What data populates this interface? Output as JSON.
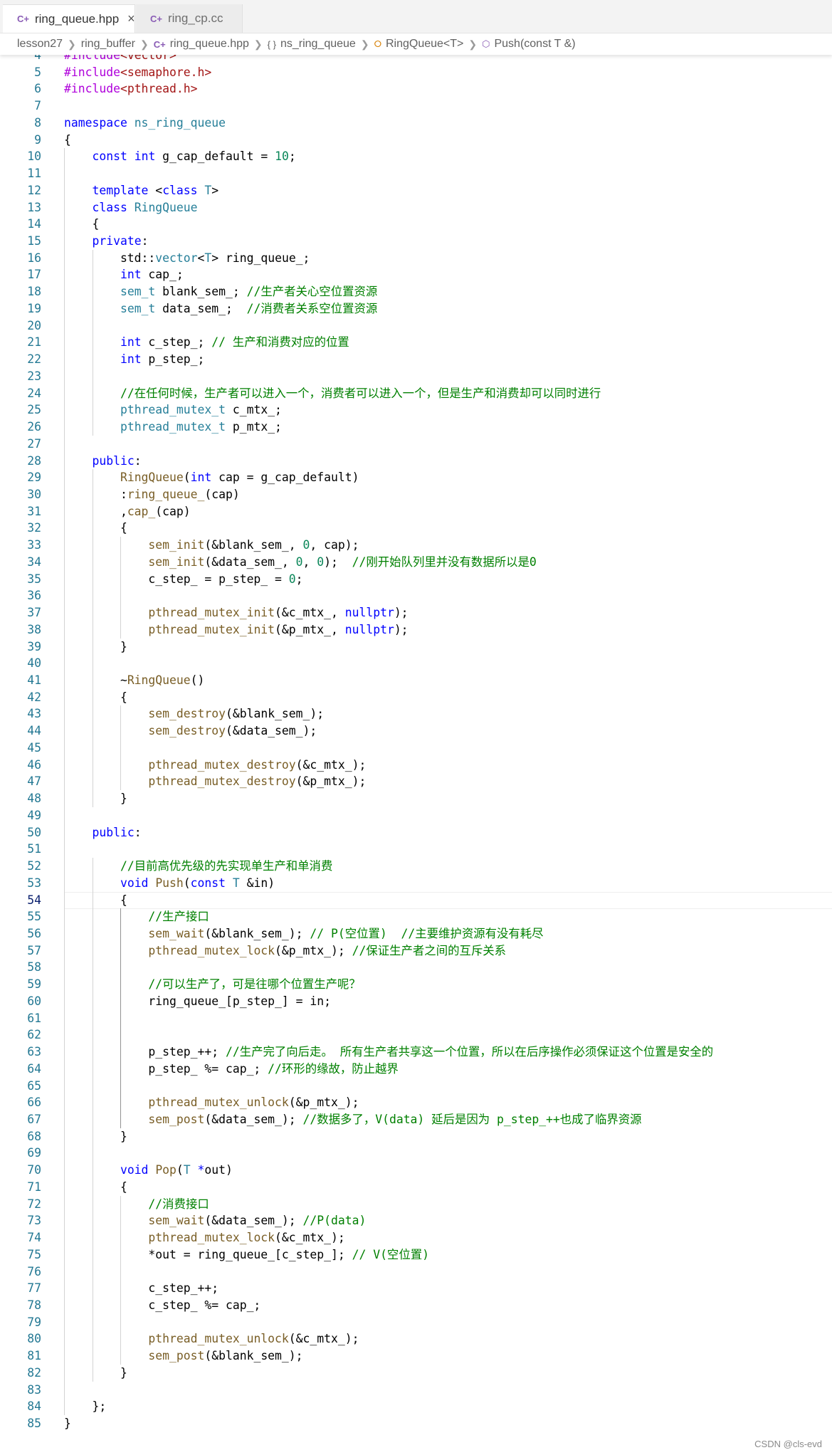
{
  "tabs": [
    {
      "label": "ring_queue.hpp",
      "active": true,
      "icon": "cpp-file-icon"
    },
    {
      "label": "ring_cp.cc",
      "active": false,
      "icon": "cpp-file-icon"
    }
  ],
  "breadcrumb": [
    "lesson27",
    "ring_buffer",
    "ring_queue.hpp",
    "ns_ring_queue",
    "RingQueue<T>",
    "Push(const T &)"
  ],
  "watermark": "CSDN @cls-evd",
  "current_line": 54,
  "lines": [
    {
      "n": 4,
      "t": [
        [
          "#include",
          "pp"
        ],
        [
          "<vector>",
          "str"
        ]
      ]
    },
    {
      "n": 5,
      "t": [
        [
          "#include",
          "pp"
        ],
        [
          "<semaphore.h>",
          "str"
        ]
      ]
    },
    {
      "n": 6,
      "t": [
        [
          "#include",
          "pp"
        ],
        [
          "<pthread.h>",
          "str"
        ]
      ]
    },
    {
      "n": 7,
      "t": []
    },
    {
      "n": 8,
      "t": [
        [
          "namespace",
          "kw"
        ],
        [
          " "
        ],
        [
          "ns_ring_queue",
          "ty"
        ]
      ]
    },
    {
      "n": 9,
      "t": [
        [
          "{"
        ]
      ]
    },
    {
      "n": 10,
      "t": [
        [
          "    "
        ],
        [
          "const",
          "kw"
        ],
        [
          " "
        ],
        [
          "int",
          "kw"
        ],
        [
          " g_cap_default = "
        ],
        [
          "10",
          "num"
        ],
        [
          ";"
        ]
      ]
    },
    {
      "n": 11,
      "t": []
    },
    {
      "n": 12,
      "t": [
        [
          "    "
        ],
        [
          "template",
          "kw"
        ],
        [
          " <"
        ],
        [
          "class",
          "kw"
        ],
        [
          " "
        ],
        [
          "T",
          "ty"
        ],
        [
          ">"
        ]
      ]
    },
    {
      "n": 13,
      "t": [
        [
          "    "
        ],
        [
          "class",
          "kw"
        ],
        [
          " "
        ],
        [
          "RingQueue",
          "ty"
        ]
      ]
    },
    {
      "n": 14,
      "t": [
        [
          "    {"
        ]
      ]
    },
    {
      "n": 15,
      "t": [
        [
          "    "
        ],
        [
          "private",
          "kw"
        ],
        [
          ":"
        ]
      ]
    },
    {
      "n": 16,
      "t": [
        [
          "        std::"
        ],
        [
          "vector",
          "ty"
        ],
        [
          "<"
        ],
        [
          "T",
          "ty"
        ],
        [
          "> ring_queue_;"
        ]
      ]
    },
    {
      "n": 17,
      "t": [
        [
          "        "
        ],
        [
          "int",
          "kw"
        ],
        [
          " cap_;"
        ]
      ]
    },
    {
      "n": 18,
      "t": [
        [
          "        "
        ],
        [
          "sem_t",
          "ty"
        ],
        [
          " blank_sem_; "
        ],
        [
          "//生产者关心空位置资源",
          "cm"
        ]
      ]
    },
    {
      "n": 19,
      "t": [
        [
          "        "
        ],
        [
          "sem_t",
          "ty"
        ],
        [
          " data_sem_;  "
        ],
        [
          "//消费者关系空位置资源",
          "cm"
        ]
      ]
    },
    {
      "n": 20,
      "t": []
    },
    {
      "n": 21,
      "t": [
        [
          "        "
        ],
        [
          "int",
          "kw"
        ],
        [
          " c_step_; "
        ],
        [
          "// 生产和消费对应的位置",
          "cm"
        ]
      ]
    },
    {
      "n": 22,
      "t": [
        [
          "        "
        ],
        [
          "int",
          "kw"
        ],
        [
          " p_step_;"
        ]
      ]
    },
    {
      "n": 23,
      "t": []
    },
    {
      "n": 24,
      "t": [
        [
          "        "
        ],
        [
          "//在任何时候，生产者可以进入一个，消费者可以进入一个，但是生产和消费却可以同时进行",
          "cm"
        ]
      ]
    },
    {
      "n": 25,
      "t": [
        [
          "        "
        ],
        [
          "pthread_mutex_t",
          "ty"
        ],
        [
          " c_mtx_;"
        ]
      ]
    },
    {
      "n": 26,
      "t": [
        [
          "        "
        ],
        [
          "pthread_mutex_t",
          "ty"
        ],
        [
          " p_mtx_;"
        ]
      ]
    },
    {
      "n": 27,
      "t": []
    },
    {
      "n": 28,
      "t": [
        [
          "    "
        ],
        [
          "public",
          "kw"
        ],
        [
          ":"
        ]
      ]
    },
    {
      "n": 29,
      "t": [
        [
          "        "
        ],
        [
          "RingQueue",
          "fn"
        ],
        [
          "("
        ],
        [
          "int",
          "kw"
        ],
        [
          " cap = g_cap_default)"
        ]
      ]
    },
    {
      "n": 30,
      "t": [
        [
          "        :"
        ],
        [
          "ring_queue_",
          "fn"
        ],
        [
          "(cap)"
        ]
      ]
    },
    {
      "n": 31,
      "t": [
        [
          "        ,"
        ],
        [
          "cap_",
          "fn"
        ],
        [
          "(cap)"
        ]
      ]
    },
    {
      "n": 32,
      "t": [
        [
          "        {"
        ]
      ]
    },
    {
      "n": 33,
      "t": [
        [
          "            "
        ],
        [
          "sem_init",
          "fn"
        ],
        [
          "(&blank_sem_, "
        ],
        [
          "0",
          "num"
        ],
        [
          ", cap);"
        ]
      ]
    },
    {
      "n": 34,
      "t": [
        [
          "            "
        ],
        [
          "sem_init",
          "fn"
        ],
        [
          "(&data_sem_, "
        ],
        [
          "0",
          "num"
        ],
        [
          ", "
        ],
        [
          "0",
          "num"
        ],
        [
          ");  "
        ],
        [
          "//刚开始队列里并没有数据所以是0",
          "cm"
        ]
      ]
    },
    {
      "n": 35,
      "t": [
        [
          "            c_step_ = p_step_ = "
        ],
        [
          "0",
          "num"
        ],
        [
          ";"
        ]
      ]
    },
    {
      "n": 36,
      "t": []
    },
    {
      "n": 37,
      "t": [
        [
          "            "
        ],
        [
          "pthread_mutex_init",
          "fn"
        ],
        [
          "(&c_mtx_, "
        ],
        [
          "nullptr",
          "kw"
        ],
        [
          ");"
        ]
      ]
    },
    {
      "n": 38,
      "t": [
        [
          "            "
        ],
        [
          "pthread_mutex_init",
          "fn"
        ],
        [
          "(&p_mtx_, "
        ],
        [
          "nullptr",
          "kw"
        ],
        [
          ");"
        ]
      ]
    },
    {
      "n": 39,
      "t": [
        [
          "        }"
        ]
      ]
    },
    {
      "n": 40,
      "t": []
    },
    {
      "n": 41,
      "t": [
        [
          "        ~"
        ],
        [
          "RingQueue",
          "fn"
        ],
        [
          "()"
        ]
      ]
    },
    {
      "n": 42,
      "t": [
        [
          "        {"
        ]
      ]
    },
    {
      "n": 43,
      "t": [
        [
          "            "
        ],
        [
          "sem_destroy",
          "fn"
        ],
        [
          "(&blank_sem_);"
        ]
      ]
    },
    {
      "n": 44,
      "t": [
        [
          "            "
        ],
        [
          "sem_destroy",
          "fn"
        ],
        [
          "(&data_sem_);"
        ]
      ]
    },
    {
      "n": 45,
      "t": []
    },
    {
      "n": 46,
      "t": [
        [
          "            "
        ],
        [
          "pthread_mutex_destroy",
          "fn"
        ],
        [
          "(&c_mtx_);"
        ]
      ]
    },
    {
      "n": 47,
      "t": [
        [
          "            "
        ],
        [
          "pthread_mutex_destroy",
          "fn"
        ],
        [
          "(&p_mtx_);"
        ]
      ]
    },
    {
      "n": 48,
      "t": [
        [
          "        }"
        ]
      ]
    },
    {
      "n": 49,
      "t": []
    },
    {
      "n": 50,
      "t": [
        [
          "    "
        ],
        [
          "public",
          "kw"
        ],
        [
          ":"
        ]
      ]
    },
    {
      "n": 51,
      "t": []
    },
    {
      "n": 52,
      "t": [
        [
          "        "
        ],
        [
          "//目前高优先级的先实现单生产和单消费",
          "cm"
        ]
      ]
    },
    {
      "n": 53,
      "t": [
        [
          "        "
        ],
        [
          "void",
          "kw"
        ],
        [
          " "
        ],
        [
          "Push",
          "fn"
        ],
        [
          "("
        ],
        [
          "const",
          "kw"
        ],
        [
          " "
        ],
        [
          "T",
          "ty"
        ],
        [
          " &in)"
        ]
      ]
    },
    {
      "n": 54,
      "t": [
        [
          "        {"
        ]
      ]
    },
    {
      "n": 55,
      "t": [
        [
          "            "
        ],
        [
          "//生产接口",
          "cm"
        ]
      ]
    },
    {
      "n": 56,
      "t": [
        [
          "            "
        ],
        [
          "sem_wait",
          "fn"
        ],
        [
          "(&blank_sem_); "
        ],
        [
          "// P(空位置)  //主要维护资源有没有耗尽",
          "cm"
        ]
      ]
    },
    {
      "n": 57,
      "t": [
        [
          "            "
        ],
        [
          "pthread_mutex_lock",
          "fn"
        ],
        [
          "(&p_mtx_); "
        ],
        [
          "//保证生产者之间的互斥关系",
          "cm"
        ]
      ]
    },
    {
      "n": 58,
      "t": []
    },
    {
      "n": 59,
      "t": [
        [
          "            "
        ],
        [
          "//可以生产了，可是往哪个位置生产呢？",
          "cm"
        ]
      ]
    },
    {
      "n": 60,
      "t": [
        [
          "            ring_queue_[p_step_] = in;"
        ]
      ]
    },
    {
      "n": 61,
      "t": []
    },
    {
      "n": 62,
      "t": []
    },
    {
      "n": 63,
      "t": [
        [
          "            p_step_++; "
        ],
        [
          "//生产完了向后走。 所有生产者共享这一个位置，所以在后序操作必须保证这个位置是安全的",
          "cm"
        ]
      ]
    },
    {
      "n": 64,
      "t": [
        [
          "            p_step_ %= cap_; "
        ],
        [
          "//环形的缘故，防止越界",
          "cm"
        ]
      ]
    },
    {
      "n": 65,
      "t": []
    },
    {
      "n": 66,
      "t": [
        [
          "            "
        ],
        [
          "pthread_mutex_unlock",
          "fn"
        ],
        [
          "(&p_mtx_);"
        ]
      ]
    },
    {
      "n": 67,
      "t": [
        [
          "            "
        ],
        [
          "sem_post",
          "fn"
        ],
        [
          "(&data_sem_); "
        ],
        [
          "//数据多了，V(data) 延后是因为 p_step_++也成了临界资源",
          "cm"
        ]
      ]
    },
    {
      "n": 68,
      "t": [
        [
          "        }"
        ]
      ]
    },
    {
      "n": 69,
      "t": []
    },
    {
      "n": 70,
      "t": [
        [
          "        "
        ],
        [
          "void",
          "kw"
        ],
        [
          " "
        ],
        [
          "Pop",
          "fn"
        ],
        [
          "("
        ],
        [
          "T",
          "ty"
        ],
        [
          " "
        ],
        [
          "*",
          "kw"
        ],
        [
          "out)"
        ]
      ]
    },
    {
      "n": 71,
      "t": [
        [
          "        {"
        ]
      ]
    },
    {
      "n": 72,
      "t": [
        [
          "            "
        ],
        [
          "//消费接口",
          "cm"
        ]
      ]
    },
    {
      "n": 73,
      "t": [
        [
          "            "
        ],
        [
          "sem_wait",
          "fn"
        ],
        [
          "(&data_sem_); "
        ],
        [
          "//P(data)",
          "cm"
        ]
      ]
    },
    {
      "n": 74,
      "t": [
        [
          "            "
        ],
        [
          "pthread_mutex_lock",
          "fn"
        ],
        [
          "(&c_mtx_);"
        ]
      ]
    },
    {
      "n": 75,
      "t": [
        [
          "            *out = ring_queue_[c_step_]; "
        ],
        [
          "// V(空位置)",
          "cm"
        ]
      ]
    },
    {
      "n": 76,
      "t": []
    },
    {
      "n": 77,
      "t": [
        [
          "            c_step_++;"
        ]
      ]
    },
    {
      "n": 78,
      "t": [
        [
          "            c_step_ %= cap_;"
        ]
      ]
    },
    {
      "n": 79,
      "t": []
    },
    {
      "n": 80,
      "t": [
        [
          "            "
        ],
        [
          "pthread_mutex_unlock",
          "fn"
        ],
        [
          "(&c_mtx_);"
        ]
      ]
    },
    {
      "n": 81,
      "t": [
        [
          "            "
        ],
        [
          "sem_post",
          "fn"
        ],
        [
          "(&blank_sem_);"
        ]
      ]
    },
    {
      "n": 82,
      "t": [
        [
          "        }"
        ]
      ]
    },
    {
      "n": 83,
      "t": []
    },
    {
      "n": 84,
      "t": [
        [
          "    };"
        ]
      ]
    },
    {
      "n": 85,
      "t": [
        [
          "}"
        ]
      ]
    }
  ]
}
